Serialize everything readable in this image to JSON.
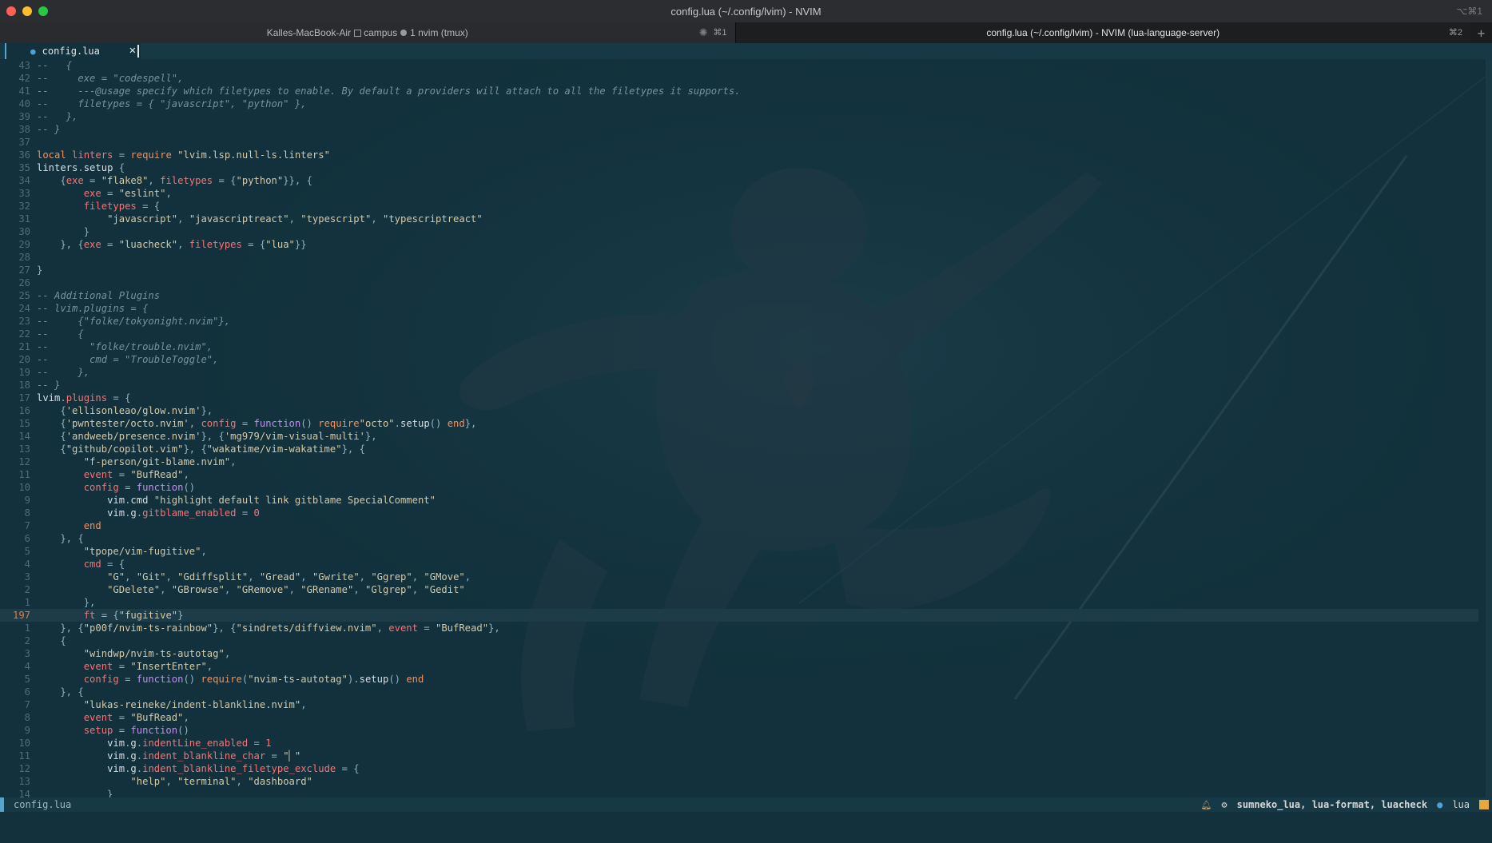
{
  "window": {
    "title": "config.lua (~/.config/lvim) - NVIM",
    "title_shortcut": "⌥⌘1"
  },
  "tabs": [
    {
      "label_host": "Kalles-MacBook-Air",
      "label_session": "campus",
      "label_win": "1 nvim (tmux)",
      "kbd": "⌘1"
    },
    {
      "label": "config.lua (~/.config/lvim) - NVIM (lua-language-server)",
      "kbd": "⌘2"
    }
  ],
  "tab_add_label": "+",
  "buffer": {
    "tab_label": "config.lua",
    "tab_icon": "lua-icon",
    "close_label": "✕"
  },
  "colors": {
    "keyword": "#ff8c4f",
    "identifier": "#d8dee4",
    "string": "#d6c9a4",
    "comment": "#7890a0",
    "field": "#ff6f6f",
    "number": "#ff6f6f",
    "function": "#c48cf2",
    "accent": "#5aa3c8"
  },
  "code_lines": [
    {
      "ln": "43",
      "text": "--   {"
    },
    {
      "ln": "42",
      "text": "--     exe = \"codespell\","
    },
    {
      "ln": "41",
      "text": "--     ---@usage specify which filetypes to enable. By default a providers will attach to all the filetypes it supports."
    },
    {
      "ln": "40",
      "text": "--     filetypes = { \"javascript\", \"python\" },"
    },
    {
      "ln": "39",
      "text": "--   },"
    },
    {
      "ln": "38",
      "text": "-- }"
    },
    {
      "ln": "37",
      "text": ""
    },
    {
      "ln": "36",
      "text": "local linters = require \"lvim.lsp.null-ls.linters\""
    },
    {
      "ln": "35",
      "text": "linters.setup {"
    },
    {
      "ln": "34",
      "text": "    {exe = \"flake8\", filetypes = {\"python\"}}, {"
    },
    {
      "ln": "33",
      "text": "        exe = \"eslint\","
    },
    {
      "ln": "32",
      "text": "        filetypes = {"
    },
    {
      "ln": "31",
      "text": "            \"javascript\", \"javascriptreact\", \"typescript\", \"typescriptreact\""
    },
    {
      "ln": "30",
      "text": "        }"
    },
    {
      "ln": "29",
      "text": "    }, {exe = \"luacheck\", filetypes = {\"lua\"}}"
    },
    {
      "ln": "28",
      "text": ""
    },
    {
      "ln": "27",
      "text": "}"
    },
    {
      "ln": "26",
      "text": ""
    },
    {
      "ln": "25",
      "text": "-- Additional Plugins"
    },
    {
      "ln": "24",
      "text": "-- lvim.plugins = {"
    },
    {
      "ln": "23",
      "text": "--     {\"folke/tokyonight.nvim\"},"
    },
    {
      "ln": "22",
      "text": "--     {"
    },
    {
      "ln": "21",
      "text": "--       \"folke/trouble.nvim\","
    },
    {
      "ln": "20",
      "text": "--       cmd = \"TroubleToggle\","
    },
    {
      "ln": "19",
      "text": "--     },"
    },
    {
      "ln": "18",
      "text": "-- }"
    },
    {
      "ln": "17",
      "text": "lvim.plugins = {"
    },
    {
      "ln": "16",
      "text": "    {'ellisonleao/glow.nvim'},"
    },
    {
      "ln": "15",
      "text": "    {'pwntester/octo.nvim', config = function() require\"octo\".setup() end},"
    },
    {
      "ln": "14",
      "text": "    {'andweeb/presence.nvim'}, {'mg979/vim-visual-multi'},"
    },
    {
      "ln": "13",
      "text": "    {\"github/copilot.vim\"}, {\"wakatime/vim-wakatime\"}, {"
    },
    {
      "ln": "12",
      "text": "        \"f-person/git-blame.nvim\","
    },
    {
      "ln": "11",
      "text": "        event = \"BufRead\","
    },
    {
      "ln": "10",
      "text": "        config = function()"
    },
    {
      "ln": "9",
      "text": "            vim.cmd \"highlight default link gitblame SpecialComment\""
    },
    {
      "ln": "8",
      "text": "            vim.g.gitblame_enabled = 0"
    },
    {
      "ln": "7",
      "text": "        end"
    },
    {
      "ln": "6",
      "text": "    }, {"
    },
    {
      "ln": "5",
      "text": "        \"tpope/vim-fugitive\","
    },
    {
      "ln": "4",
      "text": "        cmd = {"
    },
    {
      "ln": "3",
      "text": "            \"G\", \"Git\", \"Gdiffsplit\", \"Gread\", \"Gwrite\", \"Ggrep\", \"GMove\","
    },
    {
      "ln": "2",
      "text": "            \"GDelete\", \"GBrowse\", \"GRemove\", \"GRename\", \"Glgrep\", \"Gedit\""
    },
    {
      "ln": "1",
      "text": "        },"
    },
    {
      "ln": "197",
      "text": "        ft = {\"fugitive\"}",
      "current": true
    },
    {
      "ln": "1",
      "text": "    }, {\"p00f/nvim-ts-rainbow\"}, {\"sindrets/diffview.nvim\", event = \"BufRead\"},"
    },
    {
      "ln": "2",
      "text": "    {"
    },
    {
      "ln": "3",
      "text": "        \"windwp/nvim-ts-autotag\","
    },
    {
      "ln": "4",
      "text": "        event = \"InsertEnter\","
    },
    {
      "ln": "5",
      "text": "        config = function() require(\"nvim-ts-autotag\").setup() end"
    },
    {
      "ln": "6",
      "text": "    }, {"
    },
    {
      "ln": "7",
      "text": "        \"lukas-reineke/indent-blankline.nvim\","
    },
    {
      "ln": "8",
      "text": "        event = \"BufRead\","
    },
    {
      "ln": "9",
      "text": "        setup = function()"
    },
    {
      "ln": "10",
      "text": "            vim.g.indentLine_enabled = 1"
    },
    {
      "ln": "11",
      "text": "            vim.g.indent_blankline_char = \"▏\""
    },
    {
      "ln": "12",
      "text": "            vim.g.indent_blankline_filetype_exclude = {"
    },
    {
      "ln": "13",
      "text": "                \"help\", \"terminal\", \"dashboard\""
    },
    {
      "ln": "14",
      "text": "            }"
    }
  ],
  "status": {
    "filename": "config.lua",
    "lsp": "sumneko_lua, lua-format, luacheck",
    "filetype": "lua"
  }
}
